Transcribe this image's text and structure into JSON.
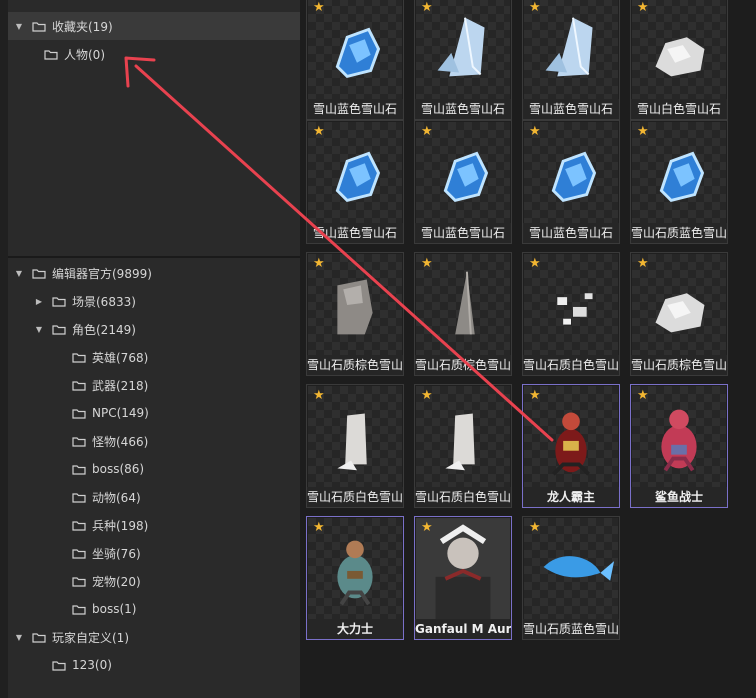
{
  "favorites": {
    "root": {
      "label": "收藏夹(19)"
    },
    "children": [
      {
        "label": "人物(0)"
      }
    ]
  },
  "tree": {
    "editor": {
      "label": "编辑器官方(9899)"
    },
    "scene": {
      "label": "场景(6833)"
    },
    "role": {
      "label": "角色(2149)"
    },
    "role_children": [
      {
        "label": "英雄(768)"
      },
      {
        "label": "武器(218)"
      },
      {
        "label": "NPC(149)"
      },
      {
        "label": "怪物(466)"
      },
      {
        "label": "boss(86)"
      },
      {
        "label": "动物(64)"
      },
      {
        "label": "兵种(198)"
      },
      {
        "label": "坐骑(76)"
      },
      {
        "label": "宠物(20)"
      },
      {
        "label": "boss(1)"
      }
    ],
    "player": {
      "label": "玩家自定义(1)"
    },
    "player_children": [
      {
        "label": "123(0)"
      }
    ]
  },
  "assets": [
    {
      "label": "雪山蓝色雪山石",
      "icon": "blue-ice-rock"
    },
    {
      "label": "雪山蓝色雪山石",
      "icon": "ice-shard"
    },
    {
      "label": "雪山蓝色雪山石",
      "icon": "ice-shard"
    },
    {
      "label": "雪山白色雪山石",
      "icon": "white-rock"
    },
    {
      "label": "雪山蓝色雪山石",
      "icon": "blue-ice-rock"
    },
    {
      "label": "雪山蓝色雪山石",
      "icon": "blue-ice-rock"
    },
    {
      "label": "雪山蓝色雪山石",
      "icon": "blue-ice-rock"
    },
    {
      "label": "雪山石质蓝色雪山",
      "icon": "blue-ice-rock"
    },
    {
      "label": "雪山石质棕色雪山",
      "icon": "grey-rock"
    },
    {
      "label": "雪山石质棕色雪山",
      "icon": "stone-spire"
    },
    {
      "label": "雪山石质白色雪山",
      "icon": "white-rubble"
    },
    {
      "label": "雪山石质棕色雪山",
      "icon": "white-rock"
    },
    {
      "label": "雪山石质白色雪山",
      "icon": "white-pillar"
    },
    {
      "label": "雪山石质白色雪山",
      "icon": "white-pillar"
    },
    {
      "label": "龙人霸主",
      "icon": "dragon-warrior"
    },
    {
      "label": "鲨鱼战士",
      "icon": "shark-warrior"
    },
    {
      "label": "大力士",
      "icon": "strongman"
    },
    {
      "label": "Ganfaul M Aure",
      "icon": "portrait"
    },
    {
      "label": "雪山石质蓝色雪山",
      "icon": "blue-fish"
    }
  ],
  "colors": {
    "accent": "#7a70c9",
    "star": "#f2b632",
    "arrow": "#e8424f"
  }
}
